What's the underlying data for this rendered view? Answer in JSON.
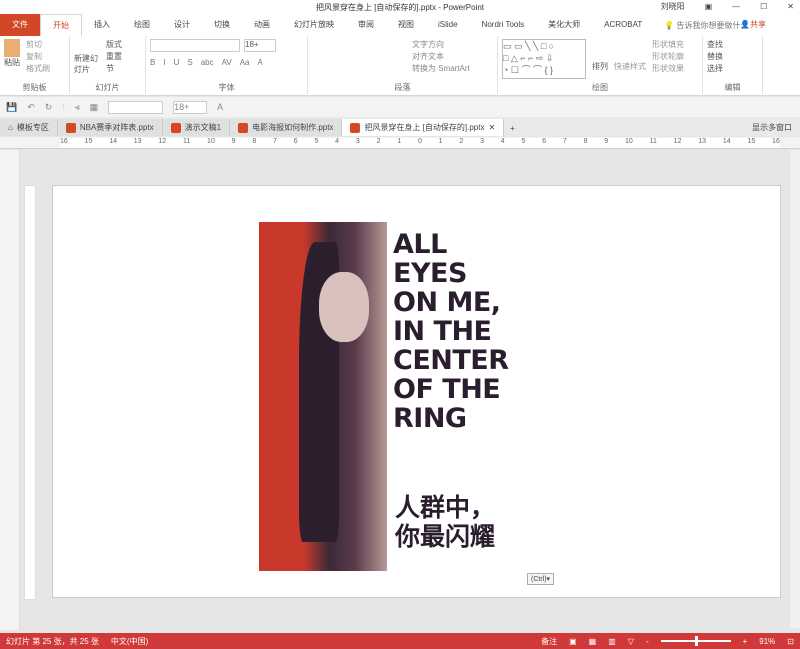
{
  "titlebar": {
    "title": "把风景穿在身上 [自动保存的].pptx - PowerPoint",
    "user": "刘晓阳"
  },
  "ribbon_tabs": [
    "文件",
    "开始",
    "插入",
    "绘图",
    "设计",
    "切换",
    "动画",
    "幻灯片放映",
    "审阅",
    "视图",
    "iSlide",
    "Nordri Tools",
    "美化大师",
    "ACROBAT"
  ],
  "tell_me": "告诉我你想要做什么",
  "share": "共享",
  "groups": {
    "clipboard": {
      "label": "剪贴板",
      "paste": "粘贴",
      "cut": "剪切",
      "copy": "复制",
      "painter": "格式刷"
    },
    "slides": {
      "label": "幻灯片",
      "new": "新建幻灯片",
      "layout": "版式",
      "reset": "重置",
      "section": "节"
    },
    "font": {
      "label": "字体",
      "size": "18+",
      "buttons": [
        "B",
        "I",
        "U",
        "S",
        "abc",
        "AV",
        "Aa",
        "A"
      ]
    },
    "paragraph": {
      "label": "段落",
      "dir": "文字方向",
      "align": "对齐文本",
      "smartart": "转换为 SmartArt"
    },
    "drawing": {
      "label": "绘图",
      "arrange": "排列",
      "quick": "快速样式",
      "fill": "形状填充",
      "outline": "形状轮廓",
      "effect": "形状效果"
    },
    "editing": {
      "label": "编辑",
      "find": "查找",
      "replace": "替换",
      "select": "选择"
    }
  },
  "qa": {
    "size": "18+"
  },
  "doc_tabs": [
    "模板专区",
    "NBA赛季对阵表.pptx",
    "演示文稿1",
    "电影海报如何制作.pptx",
    "把风景穿在身上 [自动保存的].pptx"
  ],
  "multi_window": "显示多窗口",
  "ruler": [
    "16",
    "15",
    "14",
    "13",
    "12",
    "11",
    "10",
    "9",
    "8",
    "7",
    "6",
    "5",
    "4",
    "3",
    "2",
    "1",
    "0",
    "1",
    "2",
    "3",
    "4",
    "5",
    "6",
    "7",
    "8",
    "9",
    "10",
    "11",
    "12",
    "13",
    "14",
    "15",
    "16"
  ],
  "slide": {
    "lines": [
      "ALL",
      "EYES",
      "ON ME,",
      "IN THE",
      "CENTER",
      "OF THE",
      "RING"
    ],
    "cn": [
      "人群中，",
      "你最闪耀"
    ],
    "paste_ctrl": "(Ctrl)▾"
  },
  "status": {
    "slide": "幻灯片 第 25 张，共 25 张",
    "lang": "中文(中国)",
    "notes": "备注",
    "zoom": "91%"
  }
}
